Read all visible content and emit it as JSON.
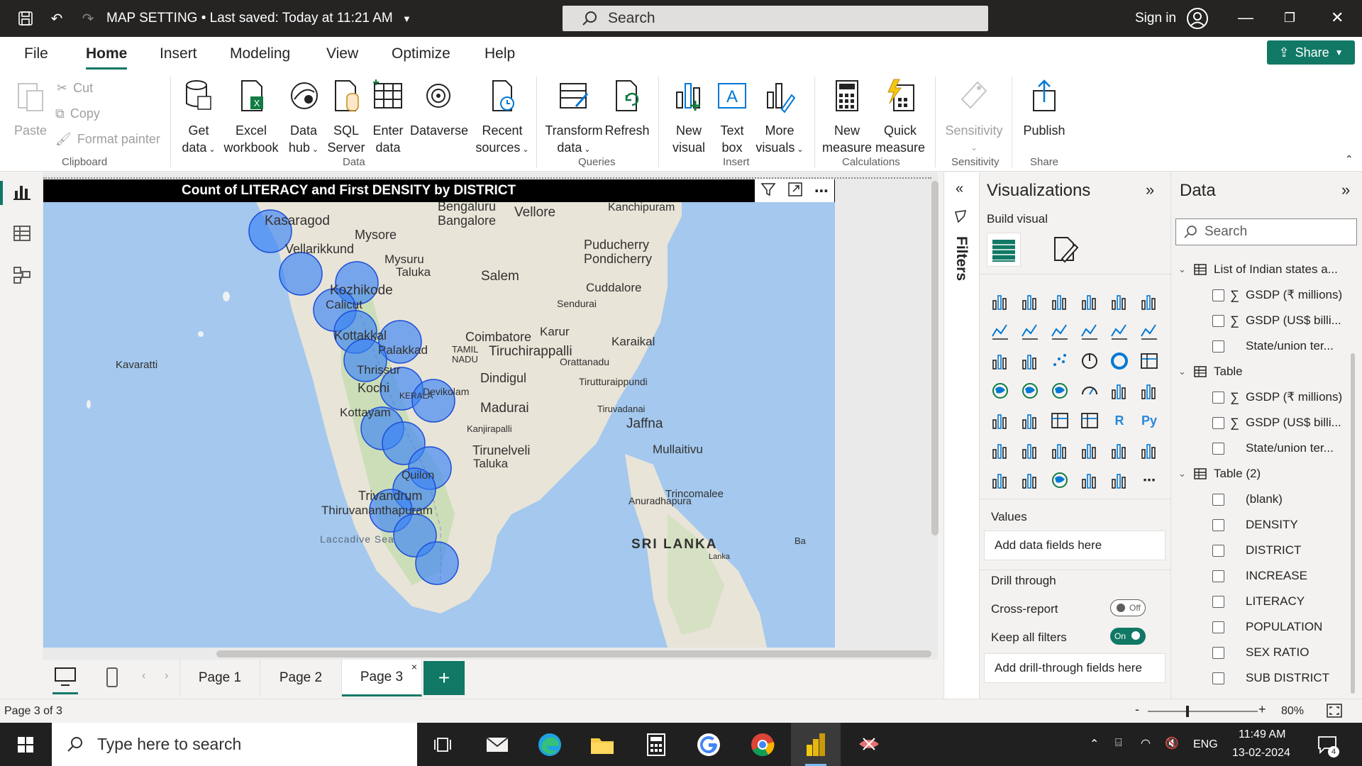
{
  "titlebar": {
    "doc_title": "MAP SETTING • Last saved: Today at 11:21 AM",
    "search_placeholder": "Search",
    "sign_in": "Sign in"
  },
  "tabs": [
    "File",
    "Home",
    "Insert",
    "Modeling",
    "View",
    "Optimize",
    "Help"
  ],
  "share_label": "Share",
  "ribbon": {
    "clipboard": {
      "paste": "Paste",
      "cut": "Cut",
      "copy": "Copy",
      "format_painter": "Format painter",
      "group": "Clipboard"
    },
    "data": {
      "get_data": [
        "Get",
        "data"
      ],
      "excel": [
        "Excel",
        "workbook"
      ],
      "data_hub": [
        "Data",
        "hub"
      ],
      "sql": [
        "SQL",
        "Server"
      ],
      "enter": [
        "Enter",
        "data"
      ],
      "dataverse": "Dataverse",
      "recent": [
        "Recent",
        "sources"
      ],
      "group": "Data"
    },
    "queries": {
      "transform": [
        "Transform",
        "data"
      ],
      "refresh": "Refresh",
      "group": "Queries"
    },
    "insert": {
      "new_visual": [
        "New",
        "visual"
      ],
      "text_box": [
        "Text",
        "box"
      ],
      "more_visuals": [
        "More",
        "visuals"
      ],
      "group": "Insert"
    },
    "calculations": {
      "new_measure": [
        "New",
        "measure"
      ],
      "quick_measure": [
        "Quick",
        "measure"
      ],
      "group": "Calculations"
    },
    "sensitivity": {
      "label": "Sensitivity",
      "group": "Sensitivity"
    },
    "share": {
      "publish": "Publish",
      "group": "Share"
    }
  },
  "visual": {
    "title": "Count of LITERACY and First DENSITY by DISTRICT",
    "map_labels": [
      "Bengaluru",
      "Bangalore",
      "Vellore",
      "Kanchipuram",
      "Kasaragod",
      "Mysore",
      "Puducherry",
      "Pondicherry",
      "Vellarikkund",
      "Mysuru",
      "Taluka",
      "Salem",
      "Kozhikode",
      "Cuddalore",
      "Calicut",
      "Sendurai",
      "Kottakkal",
      "Coimbatore",
      "Karur",
      "Kavaratti",
      "TAMIL",
      "NADU",
      "Palakkad",
      "Tiruchirappalli",
      "Karaikal",
      "Thrissur",
      "Orattanadu",
      "Dindigul",
      "Tirutturaippundi",
      "Kochi",
      "KERALA",
      "Devikolam",
      "Kottayam",
      "Madurai",
      "Tiruvadanai",
      "Jaffna",
      "Kanjirapalli",
      "Mullaitivu",
      "Tirunelveli",
      "Taluka",
      "Quilon",
      "Trivandrum",
      "Trincomalee",
      "Thiruvananthapuram",
      "Anuradhapura",
      "Laccadive Sea",
      "SRI LANKA",
      "Lanka",
      "Ba"
    ],
    "bubble_count": 16
  },
  "pages": [
    "Page 1",
    "Page 2",
    "Page 3"
  ],
  "visualizations": {
    "title": "Visualizations",
    "build": "Build visual",
    "values_label": "Values",
    "values_placeholder": "Add data fields here",
    "drill_label": "Drill through",
    "cross_report": "Cross-report",
    "cross_report_state": "Off",
    "keep_filters": "Keep all filters",
    "keep_filters_state": "On",
    "drill_placeholder": "Add drill-through fields here",
    "r_glyph": "R",
    "py_glyph": "Py"
  },
  "filters_label": "Filters",
  "data_pane": {
    "title": "Data",
    "search_placeholder": "Search",
    "tables": [
      {
        "name": "List of Indian states a...",
        "fields": [
          {
            "name": "GSDP (₹ millions)",
            "sum": true
          },
          {
            "name": "GSDP (US$ billi...",
            "sum": true
          },
          {
            "name": "State/union ter...",
            "sum": false
          }
        ]
      },
      {
        "name": "Table",
        "fields": [
          {
            "name": "GSDP (₹ millions)",
            "sum": true
          },
          {
            "name": "GSDP (US$ billi...",
            "sum": true
          },
          {
            "name": "State/union ter...",
            "sum": false
          }
        ]
      },
      {
        "name": "Table (2)",
        "fields": [
          {
            "name": "(blank)",
            "sum": false
          },
          {
            "name": "DENSITY",
            "sum": false
          },
          {
            "name": "DISTRICT",
            "sum": false
          },
          {
            "name": "INCREASE",
            "sum": false
          },
          {
            "name": "LITERACY",
            "sum": false
          },
          {
            "name": "POPULATION",
            "sum": false
          },
          {
            "name": "SEX RATIO",
            "sum": false
          },
          {
            "name": "SUB DISTRICT",
            "sum": false
          }
        ]
      }
    ]
  },
  "statusbar": {
    "page_info": "Page 3 of 3",
    "zoom": "80%"
  },
  "taskbar": {
    "search_placeholder": "Type here to search",
    "time": "11:49 AM",
    "date": "13-02-2024",
    "lang": "ENG",
    "notif_count": "4"
  },
  "colors": {
    "accent": "#117865",
    "bubble": "#3b82f6"
  }
}
